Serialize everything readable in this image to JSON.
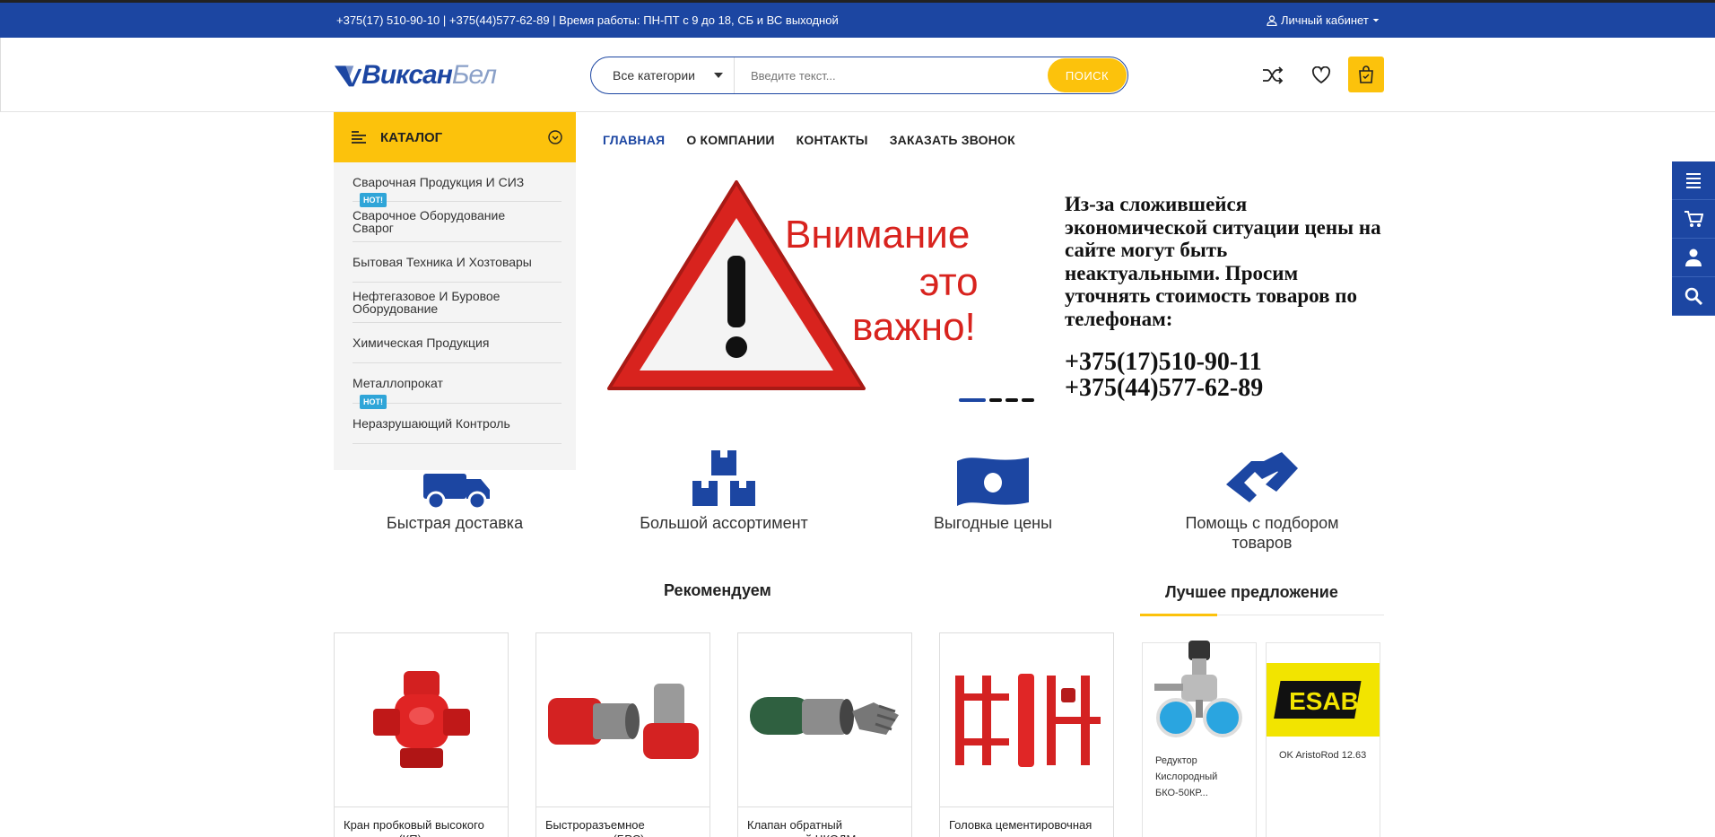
{
  "topbar": {
    "contacts": "+375(17) 510-90-10 |  +375(44)577-62-89 | Время работы: ПН-ПТ с 9 до 18, СБ и ВС выходной",
    "cabinet": "Личный кабинет"
  },
  "header": {
    "logo_part1": "Виксан",
    "logo_part2": "Бел",
    "search_category": "Все категории",
    "search_placeholder": "Введите текст...",
    "search_button": "ПОИСК"
  },
  "catalog": {
    "title": "КАТАЛОГ",
    "items": [
      {
        "label": "Сварочная Продукция И СИЗ",
        "badge": "HOT!"
      },
      {
        "label": "Сварочное Оборудование Сварог",
        "badge": ""
      },
      {
        "label": "Бытовая Техника И Хозтовары",
        "badge": ""
      },
      {
        "label": "Нефтегазовое И Буровое Оборудование",
        "badge": ""
      },
      {
        "label": "Химическая Продукция",
        "badge": ""
      },
      {
        "label": "Металлопрокат",
        "badge": "HOT!"
      },
      {
        "label": "Неразрушающий Контроль",
        "badge": ""
      }
    ]
  },
  "nav": {
    "items": [
      "ГЛАВНАЯ",
      "О КОМПАНИИ",
      "КОНТАКТЫ",
      "ЗАКАЗАТЬ ЗВОНОК"
    ]
  },
  "banner": {
    "warn_line1": "Внимание",
    "warn_line2": "это",
    "warn_line3": "важно!",
    "notice": "Из-за сложившейся экономической ситуации цены на сайте могут быть неактуальными. Просим уточнять стоимость товаров по телефонам:",
    "phone1": "+375(17)510-90-11",
    "phone2": "+375(44)577-62-89"
  },
  "features": [
    {
      "label": "Быстрая доставка",
      "icon": "truck-icon"
    },
    {
      "label": "Большой ассортимент",
      "icon": "boxes-icon"
    },
    {
      "label": "Выгодные цены",
      "icon": "money-icon"
    },
    {
      "label": "Помощь с подбором товаров",
      "icon": "handshake-icon"
    }
  ],
  "recommend": {
    "title": "Рекомендуем",
    "products": [
      {
        "name": "Кран пробковый высокого давления (КП)..."
      },
      {
        "name": "Быстроразъемное соединение (БРС)..."
      },
      {
        "name": "Клапан обратный поворотный ЧКОДМ и..."
      },
      {
        "name": "Головка цементировочная универсальная..."
      }
    ]
  },
  "best": {
    "title": "Лучшее предложение",
    "products": [
      {
        "name": "Редуктор Кислородный БКО-50КР..."
      },
      {
        "name": "OK AristoRod 12.63"
      }
    ],
    "esab_logo": "ESAB"
  },
  "colors": {
    "brand_blue": "#1c46a2",
    "accent_yellow": "#fcc20c",
    "hot_badge": "#2fa5d8",
    "warn_red": "#d8231e"
  }
}
